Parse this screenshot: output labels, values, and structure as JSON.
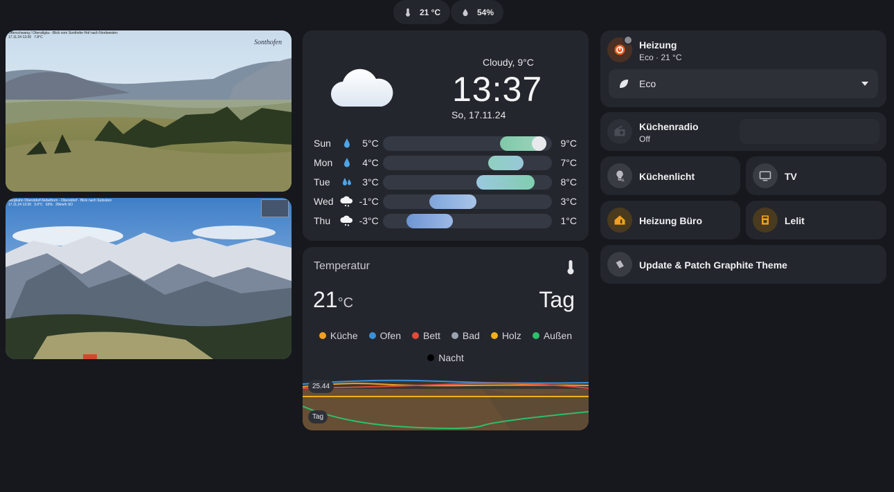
{
  "top_chips": [
    {
      "icon": "thermometer-icon",
      "value": "21 °C"
    },
    {
      "icon": "water-drop-icon",
      "value": "54%"
    }
  ],
  "webcams": [
    {
      "caption": "Ofterschwang / Oberallgäu - Blick vom Sonthofer Hof nach Nordwesten\n17.11.24 13:30   7.8°C",
      "logo": "Sonthofen"
    },
    {
      "caption": "Bergbahn Oberstdorf-Nebelhorn - Oberstdorf - Blick nach Südosten\n17.11.24 13:30   3.0°C   63%   26km/h SO",
      "logo": ""
    }
  ],
  "weather": {
    "condition": "Cloudy, 9°C",
    "time": "13:37",
    "date": "So, 17.11.24",
    "forecast": [
      {
        "day": "Sun",
        "icon": "rain-drop-icon",
        "low": "5°C",
        "high": "9°C",
        "low_val": 5,
        "high_val": 9,
        "colors": [
          "#7fc8a8",
          "#9fd6bf"
        ],
        "current": true
      },
      {
        "day": "Mon",
        "icon": "rain-drop-icon",
        "low": "4°C",
        "high": "7°C",
        "low_val": 4,
        "high_val": 7,
        "colors": [
          "#8fcfc0",
          "#98c8d8"
        ]
      },
      {
        "day": "Tue",
        "icon": "rain-drops-icon",
        "low": "3°C",
        "high": "8°C",
        "low_val": 3,
        "high_val": 8,
        "colors": [
          "#9bc8e0",
          "#80ceaf"
        ]
      },
      {
        "day": "Wed",
        "icon": "snow-cloud-icon",
        "low": "-1°C",
        "high": "3°C",
        "low_val": -1,
        "high_val": 3,
        "colors": [
          "#7fa6dc",
          "#a8c4e8"
        ]
      },
      {
        "day": "Thu",
        "icon": "snow-cloud-icon",
        "low": "-3°C",
        "high": "1°C",
        "low_val": -3,
        "high_val": 1,
        "colors": [
          "#6e95d2",
          "#9cb8e6"
        ]
      }
    ],
    "scale_min": -5,
    "scale_max": 9.5
  },
  "temperature": {
    "title": "Temperatur",
    "value": "21",
    "unit": "°C",
    "mode": "Tag",
    "legend": [
      {
        "label": "Küche",
        "color": "#f0a020"
      },
      {
        "label": "Ofen",
        "color": "#3b8fd9"
      },
      {
        "label": "Bett",
        "color": "#e04a3a"
      },
      {
        "label": "Bad",
        "color": "#9aa3b2"
      },
      {
        "label": "Holz",
        "color": "#f0b018"
      },
      {
        "label": "Außen",
        "color": "#2dbf6a"
      },
      {
        "label": "Nacht",
        "color": "#000000"
      }
    ],
    "marker_value": "25.44",
    "marker_label": "Tag"
  },
  "heating": {
    "name": "Heizung",
    "state": "Eco · 21 °C",
    "preset": "Eco",
    "accent": "#e85d1f"
  },
  "radio": {
    "name": "Küchenradio",
    "state": "Off"
  },
  "tiles": [
    {
      "name": "Küchenlicht",
      "icon": "lightbulb-icon"
    },
    {
      "name": "TV",
      "icon": "tv-icon"
    },
    {
      "name": "Heizung Büro",
      "icon": "home-thermometer-icon"
    },
    {
      "name": "Lelit",
      "icon": "coffee-maker-icon"
    }
  ],
  "update": {
    "name": "Update & Patch Graphite Theme",
    "icon": "package-icon"
  }
}
